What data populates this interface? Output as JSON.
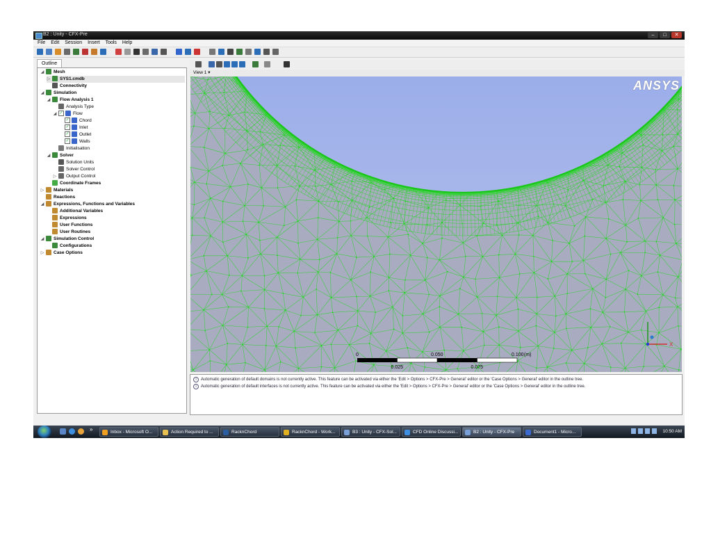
{
  "window": {
    "title": "B2 : Unity - CFX-Pre",
    "controls": [
      "–",
      "□",
      "✕"
    ]
  },
  "menu": [
    "File",
    "Edit",
    "Session",
    "Insert",
    "Tools",
    "Help"
  ],
  "left_panel": {
    "tab_label": "Outline",
    "tree": [
      {
        "label": "Mesh",
        "bold": true,
        "indent": 0,
        "exp": "open",
        "icon": "mesh-icon"
      },
      {
        "label": "SYS1.cmdb",
        "bold": true,
        "indent": 1,
        "exp": "closed",
        "icon": "mesh-file-icon",
        "selected": true
      },
      {
        "label": "Connectivity",
        "bold": true,
        "indent": 1,
        "exp": "none",
        "icon": "connectivity-icon"
      },
      {
        "label": "Simulation",
        "bold": true,
        "indent": 0,
        "exp": "open",
        "icon": "simulation-icon"
      },
      {
        "label": "Flow Analysis 1",
        "bold": true,
        "indent": 1,
        "exp": "open",
        "icon": "flow-analysis-icon"
      },
      {
        "label": "Analysis Type",
        "bold": false,
        "indent": 2,
        "exp": "none",
        "icon": "clock-icon"
      },
      {
        "label": "Flow",
        "bold": false,
        "indent": 2,
        "exp": "open",
        "icon": "domain-icon",
        "check": true
      },
      {
        "label": "Chord",
        "bold": false,
        "indent": 3,
        "exp": "none",
        "icon": "boundary-icon",
        "check": true
      },
      {
        "label": "Inlet",
        "bold": false,
        "indent": 3,
        "exp": "none",
        "icon": "boundary-icon",
        "check": true
      },
      {
        "label": "Outlet",
        "bold": false,
        "indent": 3,
        "exp": "none",
        "icon": "boundary-icon",
        "check": true
      },
      {
        "label": "Walls",
        "bold": false,
        "indent": 3,
        "exp": "none",
        "icon": "boundary-icon",
        "check": true
      },
      {
        "label": "Initialisation",
        "bold": false,
        "indent": 2,
        "exp": "none",
        "icon": "initialisation-icon"
      },
      {
        "label": "Solver",
        "bold": true,
        "indent": 1,
        "exp": "open",
        "icon": "solver-icon"
      },
      {
        "label": "Solution Units",
        "bold": false,
        "indent": 2,
        "exp": "none",
        "icon": "units-icon"
      },
      {
        "label": "Solver Control",
        "bold": false,
        "indent": 2,
        "exp": "none",
        "icon": "solver-control-icon"
      },
      {
        "label": "Output Control",
        "bold": false,
        "indent": 2,
        "exp": "closed",
        "icon": "output-control-icon"
      },
      {
        "label": "Coordinate Frames",
        "bold": true,
        "indent": 1,
        "exp": "none",
        "icon": "axes-icon"
      },
      {
        "label": "Materials",
        "bold": true,
        "indent": 0,
        "exp": "closed",
        "icon": "materials-icon"
      },
      {
        "label": "Reactions",
        "bold": true,
        "indent": 0,
        "exp": "none",
        "icon": "reactions-icon"
      },
      {
        "label": "Expressions, Functions and Variables",
        "bold": true,
        "indent": 0,
        "exp": "open",
        "icon": "expressions-icon"
      },
      {
        "label": "Additional Variables",
        "bold": true,
        "indent": 1,
        "exp": "none",
        "icon": "variables-icon"
      },
      {
        "label": "Expressions",
        "bold": true,
        "indent": 1,
        "exp": "none",
        "icon": "expression-icon"
      },
      {
        "label": "User Functions",
        "bold": true,
        "indent": 1,
        "exp": "none",
        "icon": "function-icon"
      },
      {
        "label": "User Routines",
        "bold": true,
        "indent": 1,
        "exp": "none",
        "icon": "routine-icon"
      },
      {
        "label": "Simulation Control",
        "bold": true,
        "indent": 0,
        "exp": "open",
        "icon": "simulation-control-icon"
      },
      {
        "label": "Configurations",
        "bold": true,
        "indent": 1,
        "exp": "none",
        "icon": "configurations-icon"
      },
      {
        "label": "Case Options",
        "bold": true,
        "indent": 0,
        "exp": "closed",
        "icon": "case-options-icon"
      }
    ]
  },
  "viewer": {
    "view_label": "View 1",
    "view_dropdown": "▾",
    "logo": "ANSYS",
    "scale": {
      "top_labels": [
        "0",
        "0.050",
        "0.100"
      ],
      "bottom_labels": [
        "0.025",
        "0.075"
      ],
      "unit": "(m)"
    },
    "axis_x_label": "X",
    "mesh_color": "#23d823",
    "fluid_color": "#a9abc0",
    "cylinder_color": "#7d96e6"
  },
  "messages": [
    "Automatic generation of default domains is not currently active. This feature can be activated via either the 'Edit > Options > CFX-Pre > General' editor or the 'Case Options > General' editor in the outline tree.",
    "Automatic generation of default interfaces is not currently active. This feature can be activated via either the 'Edit > Options > CFX-Pre > General' editor or the 'Case Options > General' editor in the outline tree."
  ],
  "taskbar": {
    "quicklaunch_more": "»",
    "buttons": [
      {
        "label": "Inbox - Microsoft O...",
        "icon": "outlook-icon",
        "active": false
      },
      {
        "label": "Action Required to ...",
        "icon": "folder-icon",
        "active": false
      },
      {
        "label": "RacknChord",
        "icon": "window-icon",
        "active": false
      },
      {
        "label": "RacknChord - Work...",
        "icon": "workbench-icon",
        "active": false
      },
      {
        "label": "B3 : Unity - CFX-Sol...",
        "icon": "cfx-icon",
        "active": false
      },
      {
        "label": "CFD Online Discussi...",
        "icon": "ie-icon",
        "active": false
      },
      {
        "label": "B2 : Unity - CFX-Pre",
        "icon": "cfx-icon",
        "active": true
      },
      {
        "label": "Document1 - Micro...",
        "icon": "word-icon",
        "active": false
      }
    ],
    "clock": "10:50 AM"
  }
}
